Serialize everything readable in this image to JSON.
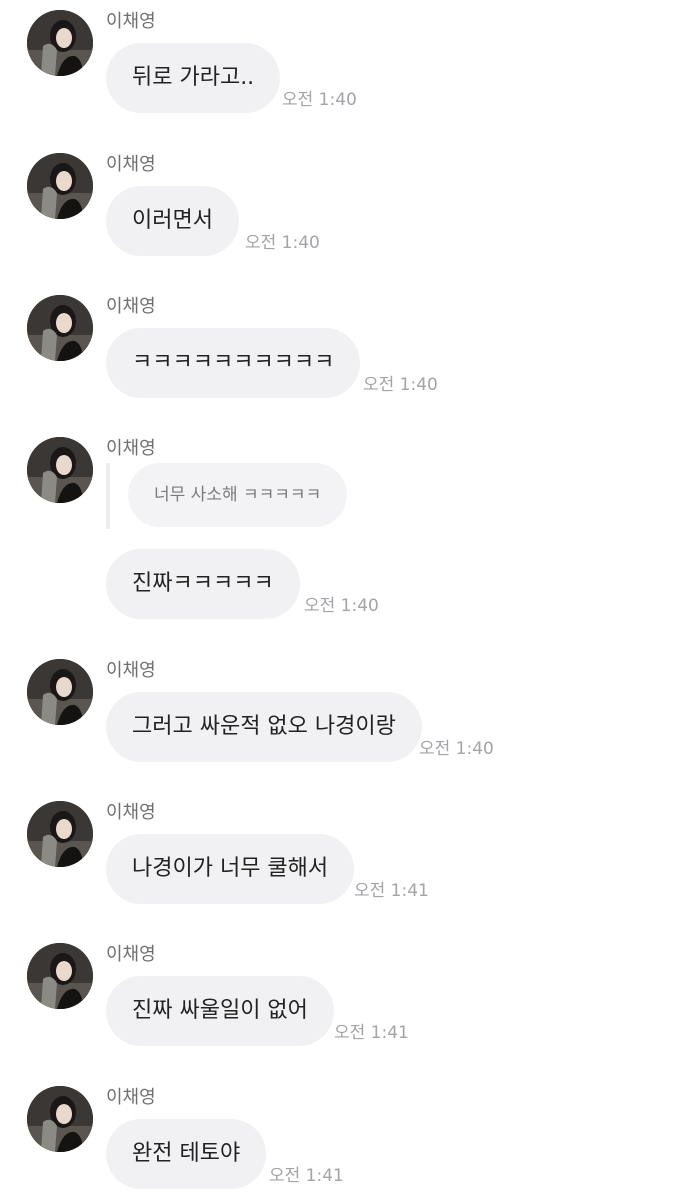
{
  "sender_name": "이채영",
  "avatar_icon": "profile-photo-avatar",
  "colors": {
    "bubble": "#f1f1f4",
    "time": "#a3a3a8",
    "sender": "#6f6f6f"
  },
  "messages": [
    {
      "text": "뒤로 가라고..",
      "time": "오전 1:40"
    },
    {
      "text": "이러면서",
      "time": "오전 1:40"
    },
    {
      "text": "ㅋㅋㅋㅋㅋㅋㅋㅋㅋㅋ",
      "time": "오전 1:40"
    },
    {
      "quote": "너무 사소해 ㅋㅋㅋㅋㅋ",
      "text": "진짜ㅋㅋㅋㅋㅋ",
      "time": "오전 1:40"
    },
    {
      "text": "그러고 싸운적 없오 나경이랑",
      "time": "오전 1:40"
    },
    {
      "text": "나경이가 너무 쿨해서",
      "time": "오전 1:41"
    },
    {
      "text": "진짜 싸울일이 없어",
      "time": "오전 1:41"
    },
    {
      "text": "완전 테토야",
      "time": "오전 1:41"
    }
  ]
}
